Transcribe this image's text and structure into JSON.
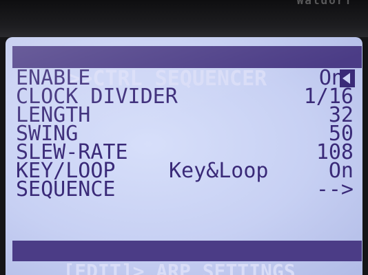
{
  "bezel": {
    "brand_text": "Waldorf"
  },
  "header": {
    "title": ">>CTRL SEQUENCER"
  },
  "params": [
    {
      "label": "ENABLE",
      "value": "On"
    },
    {
      "label": "CLOCK DIVIDER",
      "value": "1/16"
    },
    {
      "label": "LENGTH",
      "value": "32"
    },
    {
      "label": "SWING",
      "value": "50"
    },
    {
      "label": "SLEW-RATE",
      "value": "108"
    },
    {
      "label": "KEY/LOOP",
      "mode": "Key&Loop",
      "value": "On"
    },
    {
      "label": "SEQUENCE",
      "value": "-->"
    }
  ],
  "footer": {
    "edit_label": "[EDIT]",
    "nav_label": "> ARP SETTINGS"
  },
  "colors": {
    "bar": "#4b3c86",
    "text": "#3a2a78",
    "screen": "#c7d0f3"
  }
}
